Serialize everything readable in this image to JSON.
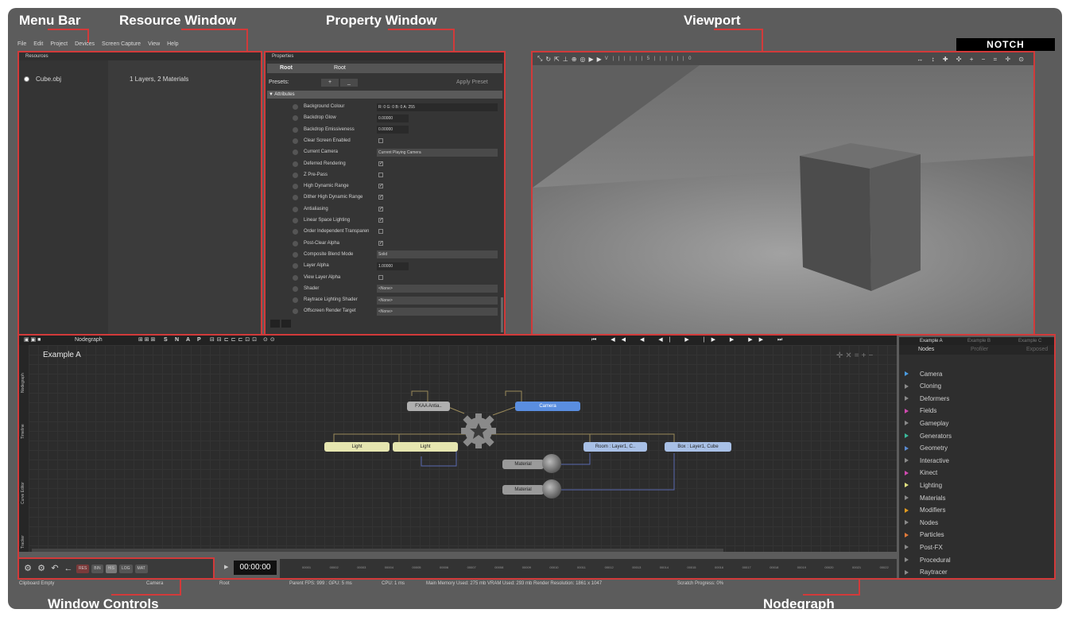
{
  "callouts": {
    "menu_bar": "Menu Bar",
    "resource_window": "Resource Window",
    "property_window": "Property Window",
    "viewport": "Viewport",
    "window_controls": "Window Controls",
    "nodegraph": "Nodegraph"
  },
  "brand": "NOTCH",
  "menu": [
    "File",
    "Edit",
    "Project",
    "Devices",
    "Screen Capture",
    "View",
    "Help"
  ],
  "resources": {
    "title": "Resources",
    "items": [
      {
        "name": "Cube.obj",
        "info": "1 Layers, 2 Materials"
      }
    ]
  },
  "properties": {
    "title": "Properties",
    "root_label": "Root",
    "root_value": "Root",
    "presets_label": "Presets:",
    "apply_preset": "Apply Preset",
    "attributes_label": "Attributes",
    "rows": [
      {
        "label": "Background Colour",
        "kind": "color",
        "value": "R: 0 G: 0 B: 0 A: 255"
      },
      {
        "label": "Backdrop Glow",
        "kind": "num",
        "value": "0.00000"
      },
      {
        "label": "Backdrop Emissiveness",
        "kind": "num",
        "value": "0.00000"
      },
      {
        "label": "Clear Screen Enabled",
        "kind": "check",
        "value": ""
      },
      {
        "label": "Current Camera",
        "kind": "select",
        "value": "Current Playing Camera"
      },
      {
        "label": "Deferred Rendering",
        "kind": "check",
        "value": "✓"
      },
      {
        "label": "Z Pre-Pass",
        "kind": "check",
        "value": ""
      },
      {
        "label": "High Dynamic Range",
        "kind": "check",
        "value": "✓"
      },
      {
        "label": "Dither High Dynamic Range",
        "kind": "check",
        "value": "✓"
      },
      {
        "label": "Antialiasing",
        "kind": "check",
        "value": "✓"
      },
      {
        "label": "Linear Space Lighting",
        "kind": "check",
        "value": "✓"
      },
      {
        "label": "Order Independent Transparen",
        "kind": "check",
        "value": ""
      },
      {
        "label": "Post-Clear Alpha",
        "kind": "check",
        "value": "✓"
      },
      {
        "label": "Composite Blend Mode",
        "kind": "select",
        "value": "Solid"
      },
      {
        "label": "Layer Alpha",
        "kind": "num",
        "value": "1.00000"
      },
      {
        "label": "View Layer Alpha",
        "kind": "check",
        "value": ""
      },
      {
        "label": "Shader",
        "kind": "select",
        "value": "<None>"
      },
      {
        "label": "Raytrace Lighting Shader",
        "kind": "select",
        "value": "<None>"
      },
      {
        "label": "Offscreen Render Target",
        "kind": "select",
        "value": "<None>"
      }
    ]
  },
  "nodegraph": {
    "title": "Nodegraph",
    "graph_name": "Example A",
    "toolbar_letters": [
      "S",
      "N",
      "A",
      "P"
    ],
    "nodes": {
      "fxaa": "FXAA Antia..",
      "camera": "Camera",
      "light1": "Light",
      "light2": "Light",
      "room": "Room : Layer1, C..",
      "box": "Box : Layer1, Cube",
      "material1": "Material",
      "material2": "Material"
    },
    "side_tabs": [
      "Nodegraph",
      "Timeline",
      "Curve Editor",
      "Tracker"
    ]
  },
  "library": {
    "tabs": [
      "Example A",
      "Example B",
      "Example C"
    ],
    "subtabs": [
      "Nodes",
      "Profiler",
      "Exposed"
    ],
    "categories": [
      {
        "name": "Camera",
        "color": "#4a9be0"
      },
      {
        "name": "Cloning",
        "color": "#8a8a8a"
      },
      {
        "name": "Deformers",
        "color": "#8a8a8a"
      },
      {
        "name": "Fields",
        "color": "#d04ab0"
      },
      {
        "name": "Gameplay",
        "color": "#8a8a8a"
      },
      {
        "name": "Generators",
        "color": "#3ab89a"
      },
      {
        "name": "Geometry",
        "color": "#5a8ad0"
      },
      {
        "name": "Interactive",
        "color": "#8a8a8a"
      },
      {
        "name": "Kinect",
        "color": "#d04ab0"
      },
      {
        "name": "Lighting",
        "color": "#e0e080"
      },
      {
        "name": "Materials",
        "color": "#8a8a8a"
      },
      {
        "name": "Modifiers",
        "color": "#e09a20"
      },
      {
        "name": "Nodes",
        "color": "#8a8a8a"
      },
      {
        "name": "Particles",
        "color": "#e07a3a"
      },
      {
        "name": "Post-FX",
        "color": "#8a8a8a"
      },
      {
        "name": "Procedural",
        "color": "#8a8a8a"
      },
      {
        "name": "Raytracer",
        "color": "#8a8a8a"
      }
    ]
  },
  "window_controls": {
    "buttons": [
      "RES",
      "BIN",
      "HIS",
      "LOG",
      "MAT"
    ]
  },
  "timecode": "00:00:00",
  "timeline_ticks": [
    "00001",
    "00002",
    "00003",
    "00004",
    "00005",
    "00006",
    "00007",
    "00008",
    "00009",
    "00010",
    "00011",
    "00012",
    "00013",
    "00014",
    "00015",
    "00016",
    "00017",
    "00018",
    "00019",
    "00020",
    "00021",
    "00022"
  ],
  "status": {
    "clipboard": "Clipboard Empty",
    "camera": "Camera",
    "root": "Root",
    "fps": "Parent FPS: 999 : GPU: 5 ms",
    "cpu": "CPU: 1 ms",
    "memory": "Main Memory Used: 275 mb VRAM Used: 293 mb Render Resolution: 1861 x 1047",
    "scratch": "Scratch Progress: 0%"
  }
}
